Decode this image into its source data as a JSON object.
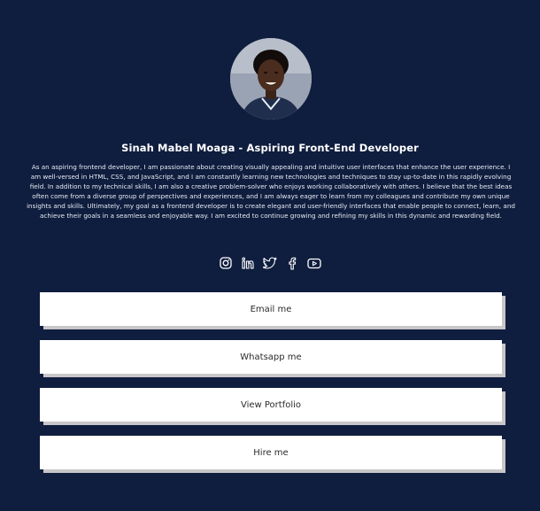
{
  "profile": {
    "name": "Sinah Mabel Moaga - Aspiring Front-End Developer",
    "bio": "As an aspiring frontend developer, I am passionate about creating visually appealing and intuitive user interfaces that enhance the user experience. I am well-versed in HTML, CSS, and JavaScript, and I am constantly learning new technologies and techniques to stay up-to-date in this rapidly evolving field. In addition to my technical skills, I am also a creative problem-solver who enjoys working collaboratively with others. I believe that the best ideas often come from a diverse group of perspectives and experiences, and I am always eager to learn from my colleagues and contribute my own unique insights and skills. Ultimately, my goal as a frontend developer is to create elegant and user-friendly interfaces that enable people to connect, learn, and achieve their goals in a seamless and enjoyable way. I am excited to continue growing and refining my skills in this dynamic and rewarding field."
  },
  "socials": [
    {
      "icon": "instagram-icon"
    },
    {
      "icon": "linkedin-icon"
    },
    {
      "icon": "twitter-icon"
    },
    {
      "icon": "facebook-icon"
    },
    {
      "icon": "youtube-icon"
    }
  ],
  "buttons": [
    {
      "label": "Email me"
    },
    {
      "label": "Whatsapp me"
    },
    {
      "label": "View Portfolio"
    },
    {
      "label": "Hire me"
    }
  ],
  "colors": {
    "background": "#0f1d3e",
    "button_bg": "#ffffff",
    "button_shadow": "#c9c6c9"
  }
}
